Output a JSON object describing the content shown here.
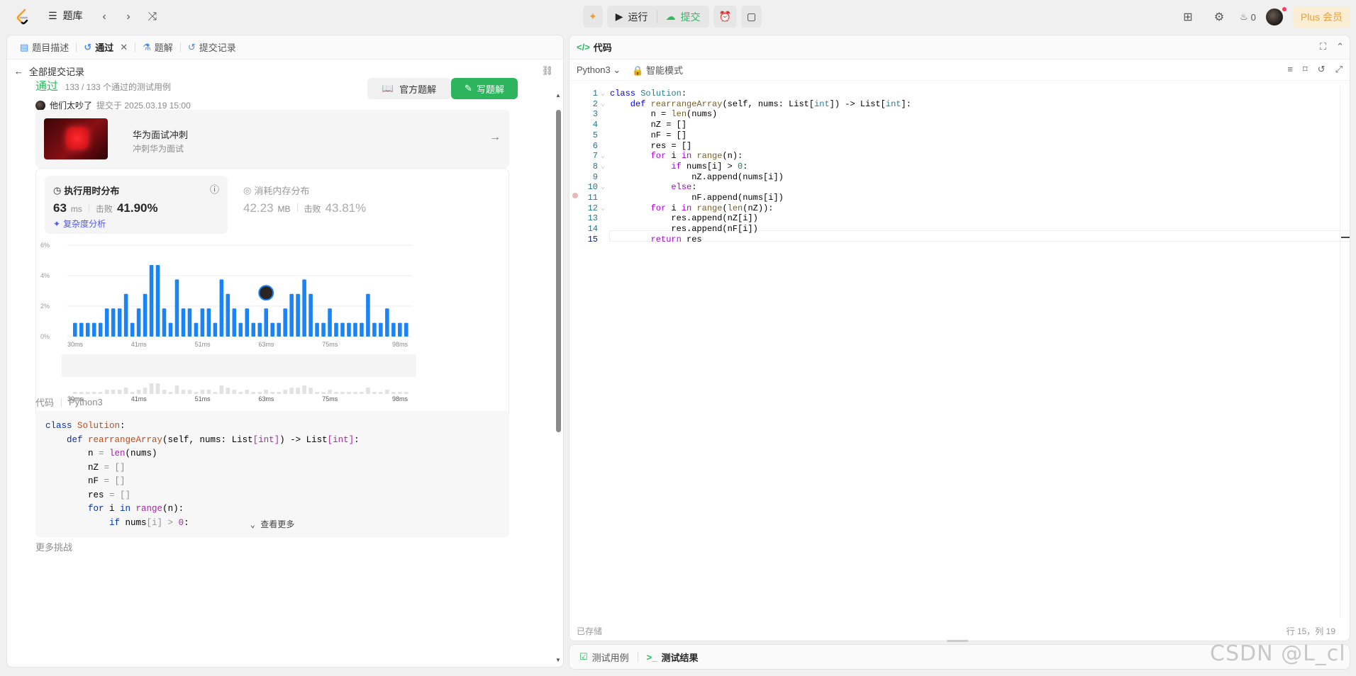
{
  "topbar": {
    "problem_library": "题库",
    "run_label": "运行",
    "submit_label": "提交",
    "streak_count": "0",
    "plus_label": "Plus 会员"
  },
  "left_tabs": [
    {
      "label": "题目描述"
    },
    {
      "label": "通过"
    },
    {
      "label": "题解"
    },
    {
      "label": "提交记录"
    }
  ],
  "back_label": "全部提交记录",
  "submission": {
    "status": "通过",
    "cases": "133 / 133 个通过的测试用例",
    "user": "他们太吵了",
    "submitted_at": "提交于 2025.03.19 15:00",
    "official_solution": "官方题解",
    "write_solution": "写题解"
  },
  "banner": {
    "title": "华为面试冲刺",
    "subtitle": "冲刺华为面试"
  },
  "runtime": {
    "title": "执行用时分布",
    "value": "63",
    "unit": "ms",
    "beats_label": "击败",
    "beats": "41.90%",
    "complexity": "复杂度分析"
  },
  "memory": {
    "title": "消耗内存分布",
    "value": "42.23",
    "unit": "MB",
    "beats_label": "击败",
    "beats": "43.81%"
  },
  "chart_data": {
    "type": "bar",
    "title": "执行用时分布",
    "ylim": [
      0,
      6
    ],
    "yticks": [
      "0%",
      "2%",
      "4%",
      "6%"
    ],
    "xticks": [
      "30ms",
      "41ms",
      "51ms",
      "63ms",
      "75ms",
      "98ms"
    ],
    "values": [
      0.9,
      0.9,
      0.9,
      0.9,
      0.9,
      1.85,
      1.85,
      1.85,
      2.8,
      0.9,
      1.85,
      2.8,
      4.7,
      4.7,
      1.85,
      0.9,
      3.75,
      1.85,
      1.85,
      0.9,
      1.85,
      1.85,
      0.9,
      3.75,
      2.8,
      1.85,
      0.9,
      1.85,
      0.9,
      0.9,
      1.85,
      0.9,
      0.9,
      1.85,
      2.8,
      2.8,
      3.75,
      2.8,
      0.9,
      0.9,
      1.85,
      0.9,
      0.9,
      0.9,
      0.9,
      0.9,
      2.8,
      0.9,
      0.9,
      1.85,
      0.9,
      0.9,
      0.9
    ],
    "user_bar_index": 30,
    "bar_color": "#1a83f6",
    "grid": true
  },
  "code_label": "代码",
  "code_lang": "Python3",
  "preview_code": [
    [
      [
        "class ",
        "pk"
      ],
      [
        "Solution",
        "pn"
      ],
      [
        ":",
        "pv"
      ]
    ],
    [
      [
        "    def ",
        "pk"
      ],
      [
        "rearrangeArray",
        "pn"
      ],
      [
        "(self, nums: List",
        "pv"
      ],
      [
        "[int]",
        "pf"
      ],
      [
        ") -> List",
        "pv"
      ],
      [
        "[int]",
        "pf"
      ],
      [
        ":",
        "pv"
      ]
    ],
    [
      [
        "        n ",
        "pv"
      ],
      [
        "= ",
        "pgrey"
      ],
      [
        "len",
        "pf"
      ],
      [
        "(nums)",
        "pv"
      ]
    ],
    [
      [
        "        nZ ",
        "pv"
      ],
      [
        "= []",
        "pgrey"
      ]
    ],
    [
      [
        "        nF ",
        "pv"
      ],
      [
        "= []",
        "pgrey"
      ]
    ],
    [
      [
        "        res ",
        "pv"
      ],
      [
        "= []",
        "pgrey"
      ]
    ],
    [
      [
        "        for ",
        "pk"
      ],
      [
        "i ",
        "pv"
      ],
      [
        "in ",
        "pk"
      ],
      [
        "range",
        "pf"
      ],
      [
        "(n):",
        "pv"
      ]
    ],
    [
      [
        "            if ",
        "pk"
      ],
      [
        "nums",
        "pv"
      ],
      [
        "[i] > ",
        "pgrey"
      ],
      [
        "0",
        "pf"
      ],
      [
        ":",
        "pv"
      ]
    ]
  ],
  "view_more": "查看更多",
  "more_challenges": "更多挑战",
  "editor": {
    "tab_label": "代码",
    "language": "Python3",
    "smart_mode": "智能模式",
    "saved": "已存储",
    "cursor": "行 15，列 19",
    "lines": [
      [
        [
          "class ",
          "kw"
        ],
        [
          "Solution",
          "cls"
        ],
        [
          ":",
          ""
        ]
      ],
      [
        [
          "    def ",
          "kw"
        ],
        [
          "rearrangeArray",
          "fn"
        ],
        [
          "(self, nums: List[",
          ""
        ],
        [
          "int",
          "ty"
        ],
        [
          "]) -> List[",
          ""
        ],
        [
          "int",
          "ty"
        ],
        [
          "]:",
          ""
        ]
      ],
      [
        [
          "        n = ",
          ""
        ],
        [
          "len",
          "fn"
        ],
        [
          "(nums)",
          ""
        ]
      ],
      [
        [
          "        nZ = []",
          ""
        ]
      ],
      [
        [
          "        nF = []",
          ""
        ]
      ],
      [
        [
          "        res = []",
          ""
        ]
      ],
      [
        [
          "        for ",
          "kw2"
        ],
        [
          "i ",
          ""
        ],
        [
          "in ",
          "kw2"
        ],
        [
          "range",
          "fn"
        ],
        [
          "(n):",
          ""
        ]
      ],
      [
        [
          "            if ",
          "kw2"
        ],
        [
          "nums[i] > ",
          ""
        ],
        [
          "0",
          "num"
        ],
        [
          ":",
          ""
        ]
      ],
      [
        [
          "                nZ.append(nums[i])",
          ""
        ]
      ],
      [
        [
          "            else",
          "kw2"
        ],
        [
          ":",
          ""
        ]
      ],
      [
        [
          "                nF.append(nums[i])",
          ""
        ]
      ],
      [
        [
          "        for ",
          "kw2"
        ],
        [
          "i ",
          ""
        ],
        [
          "in ",
          "kw2"
        ],
        [
          "range",
          "fn"
        ],
        [
          "(",
          ""
        ],
        [
          "len",
          "fn"
        ],
        [
          "(nZ)):",
          ""
        ]
      ],
      [
        [
          "            res.append(nZ[i])",
          ""
        ]
      ],
      [
        [
          "            res.append(nF[i])",
          ""
        ]
      ],
      [
        [
          "        return ",
          "kw2"
        ],
        [
          "res",
          ""
        ]
      ]
    ]
  },
  "bottom_tabs": [
    {
      "label": "测试用例"
    },
    {
      "label": "测试结果"
    }
  ],
  "watermark": "CSDN @L_cl"
}
